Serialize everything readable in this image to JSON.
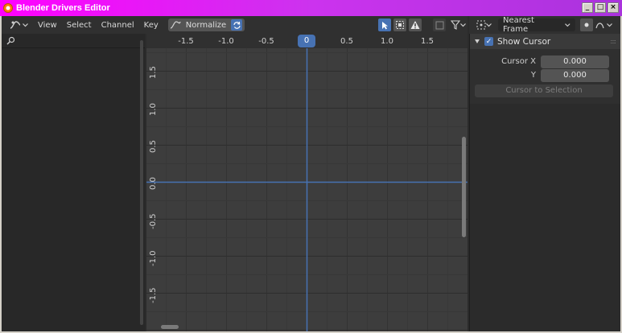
{
  "window": {
    "title": "Blender Drivers Editor",
    "buttons": [
      "_",
      "□",
      "×"
    ]
  },
  "header": {
    "menus": [
      "View",
      "Select",
      "Channel",
      "Key"
    ],
    "normalize_label": "Normalize",
    "snap_mode": "Nearest Frame"
  },
  "graph": {
    "x_ticks": [
      "-1.5",
      "-1.0",
      "-0.5",
      "0",
      "0.5",
      "1.0",
      "1.5"
    ],
    "y_ticks": [
      "1.5",
      "1.0",
      "0.5",
      "0.0",
      "-0.5",
      "-1.0",
      "-1.5"
    ],
    "cursor_frame": "0"
  },
  "sidebar": {
    "panel_title": "Show Cursor",
    "cursor_x_label": "Cursor X",
    "cursor_x_value": "0.000",
    "y_label": "Y",
    "y_value": "0.000",
    "cursor_to_selection": "Cursor to Selection"
  },
  "colors": {
    "accent": "#4772b3",
    "title_bar": "#ff00ff"
  }
}
